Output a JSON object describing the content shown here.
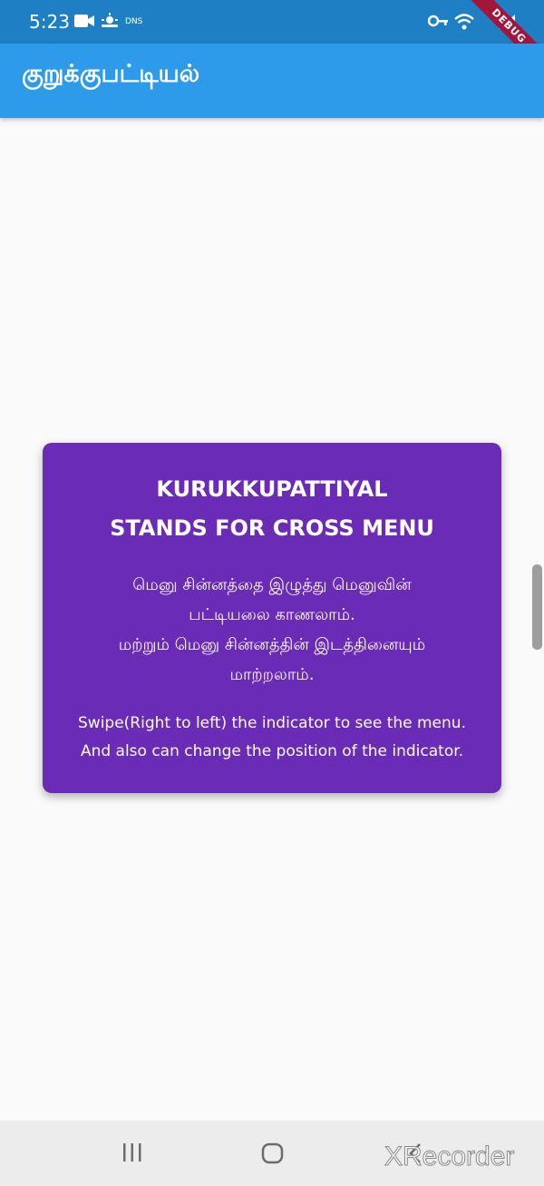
{
  "status_bar": {
    "time": "5:23",
    "dns_label": "DNS",
    "icons": [
      "video-icon",
      "weather-icon",
      "key-icon",
      "wifi-icon",
      "signal-icon"
    ],
    "debug_banner": "DEBUG"
  },
  "app_bar": {
    "title": "குறுக்குபட்டியல்",
    "color": "#2e9bea"
  },
  "card": {
    "color": "#6a2bb7",
    "heading": [
      "KURUKKUPATTIYAL",
      "STANDS FOR CROSS MENU"
    ],
    "tamil_lines": [
      "மெனு சின்னத்தை இழுத்து மெனுவின்",
      "பட்டியலை காணலாம்.",
      "மற்றும் மெனு சின்னத்தின் இடத்தினையும்",
      "மாற்றலாம்."
    ],
    "english_lines": [
      "Swipe(Right to left) the indicator to see the menu.",
      "And also can change the position of the indicator."
    ]
  },
  "nav_bar": {
    "buttons": [
      "recents-icon",
      "home-icon",
      "back-icon"
    ]
  },
  "watermark": "XRecorder"
}
